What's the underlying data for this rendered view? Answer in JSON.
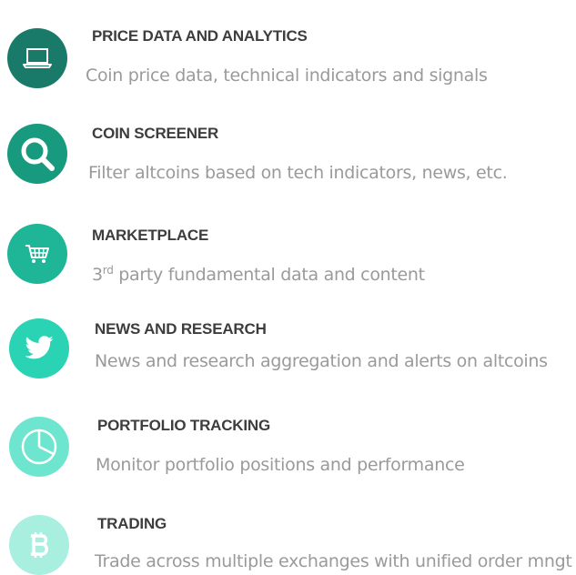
{
  "features": [
    {
      "title": "PRICE DATA AND ANALYTICS",
      "description": "Coin price data, technical indicators and signals",
      "icon": "laptop-icon",
      "color": "#1a7a6a"
    },
    {
      "title": "COIN SCREENER",
      "description": "Filter altcoins based on tech indicators, news, etc.",
      "icon": "magnifier-icon",
      "color": "#179a7d"
    },
    {
      "title": "MARKETPLACE",
      "description_prefix": "3",
      "description_sup": "rd",
      "description_rest": " party fundamental data and content",
      "icon": "shopping-cart-icon",
      "color": "#1fb597"
    },
    {
      "title": "NEWS AND RESEARCH",
      "description": "News and research aggregation and alerts on altcoins",
      "icon": "twitter-bird-icon",
      "color": "#2ad3b3"
    },
    {
      "title": "PORTFOLIO TRACKING",
      "description": "Monitor portfolio positions and performance",
      "icon": "pie-chart-icon",
      "color": "#6ee6cf"
    },
    {
      "title": "TRADING",
      "description": "Trade across multiple exchanges with unified order mngt",
      "icon": "bitcoin-icon",
      "color": "#a8efe0"
    }
  ]
}
